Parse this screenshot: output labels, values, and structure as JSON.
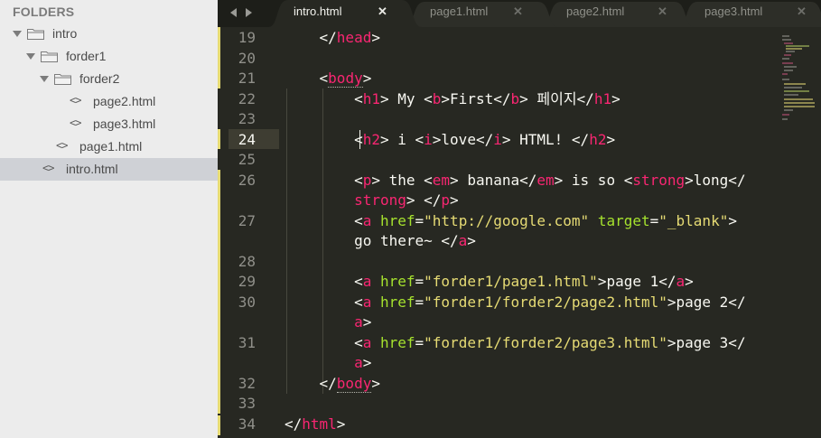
{
  "sidebar": {
    "header": "FOLDERS",
    "items": [
      {
        "label": "intro",
        "type": "folder",
        "expanded": true,
        "selected": false
      },
      {
        "label": "forder1",
        "type": "folder",
        "expanded": true,
        "selected": false
      },
      {
        "label": "forder2",
        "type": "folder",
        "expanded": true,
        "selected": false
      },
      {
        "label": "page2.html",
        "type": "file",
        "icon": "code-file-icon",
        "selected": false
      },
      {
        "label": "page3.html",
        "type": "file",
        "icon": "code-file-icon",
        "selected": false
      },
      {
        "label": "page1.html",
        "type": "file",
        "icon": "code-file-icon",
        "selected": false
      },
      {
        "label": "intro.html",
        "type": "file",
        "icon": "code-file-icon",
        "selected": true
      }
    ]
  },
  "tabs": [
    {
      "label": "intro.html",
      "active": true,
      "close": "✕"
    },
    {
      "label": "page1.html",
      "active": false,
      "close": "✕"
    },
    {
      "label": "page2.html",
      "active": false,
      "close": "✕"
    },
    {
      "label": "page3.html",
      "active": false,
      "close": "✕"
    }
  ],
  "editor": {
    "current_line": 24,
    "line_numbers": [
      "19",
      "20",
      "21",
      "22",
      "23",
      "24",
      "25",
      "26",
      "27",
      "28",
      "29",
      "30",
      "31",
      "32",
      "33",
      "34"
    ],
    "code_lines": [
      [
        {
          "text": "    </"
        },
        {
          "text": "head",
          "k": "t"
        },
        {
          "text": ">"
        }
      ],
      [],
      [
        {
          "text": "    <"
        },
        {
          "text": "body",
          "k": "t",
          "u": true
        },
        {
          "text": ">"
        }
      ],
      [
        {
          "text": "        <"
        },
        {
          "text": "h1",
          "k": "t"
        },
        {
          "text": "> My <"
        },
        {
          "text": "b",
          "k": "t"
        },
        {
          "text": ">First</"
        },
        {
          "text": "b",
          "k": "t"
        },
        {
          "text": "> 페이지</"
        },
        {
          "text": "h1",
          "k": "t"
        },
        {
          "text": ">"
        }
      ],
      [],
      [
        {
          "text": "        <"
        },
        {
          "text": "h2",
          "k": "t"
        },
        {
          "text": "> i <"
        },
        {
          "text": "i",
          "k": "t"
        },
        {
          "text": ">love</"
        },
        {
          "text": "i",
          "k": "t"
        },
        {
          "text": "> HTML! </"
        },
        {
          "text": "h2",
          "k": "t"
        },
        {
          "text": ">"
        }
      ],
      [],
      [
        {
          "text": "        <"
        },
        {
          "text": "p",
          "k": "t"
        },
        {
          "text": "> the <"
        },
        {
          "text": "em",
          "k": "t"
        },
        {
          "text": "> banana</"
        },
        {
          "text": "em",
          "k": "t"
        },
        {
          "text": "> is so <"
        },
        {
          "text": "strong",
          "k": "t"
        },
        {
          "text": ">long</"
        }
      ],
      [
        {
          "text": "        "
        },
        {
          "text": "strong",
          "k": "t"
        },
        {
          "text": "> </"
        },
        {
          "text": "p",
          "k": "t"
        },
        {
          "text": ">"
        }
      ],
      [
        {
          "text": "        <"
        },
        {
          "text": "a",
          "k": "t"
        },
        {
          "text": " "
        },
        {
          "text": "href",
          "k": "a"
        },
        {
          "text": "="
        },
        {
          "text": "\"http://google.com\"",
          "k": "s"
        },
        {
          "text": " "
        },
        {
          "text": "target",
          "k": "a"
        },
        {
          "text": "="
        },
        {
          "text": "\"_blank\"",
          "k": "s"
        },
        {
          "text": ">"
        }
      ],
      [
        {
          "text": "        go there~ </"
        },
        {
          "text": "a",
          "k": "t"
        },
        {
          "text": ">"
        }
      ],
      [],
      [
        {
          "text": "        <"
        },
        {
          "text": "a",
          "k": "t"
        },
        {
          "text": " "
        },
        {
          "text": "href",
          "k": "a"
        },
        {
          "text": "="
        },
        {
          "text": "\"forder1/page1.html\"",
          "k": "s"
        },
        {
          "text": ">page 1</"
        },
        {
          "text": "a",
          "k": "t"
        },
        {
          "text": ">"
        }
      ],
      [
        {
          "text": "        <"
        },
        {
          "text": "a",
          "k": "t"
        },
        {
          "text": " "
        },
        {
          "text": "href",
          "k": "a"
        },
        {
          "text": "="
        },
        {
          "text": "\"forder1/forder2/page2.html\"",
          "k": "s"
        },
        {
          "text": ">page 2</"
        }
      ],
      [
        {
          "text": "        "
        },
        {
          "text": "a",
          "k": "t"
        },
        {
          "text": ">"
        }
      ],
      [
        {
          "text": "        <"
        },
        {
          "text": "a",
          "k": "t"
        },
        {
          "text": " "
        },
        {
          "text": "href",
          "k": "a"
        },
        {
          "text": "="
        },
        {
          "text": "\"forder1/forder2/page3.html\"",
          "k": "s"
        },
        {
          "text": ">page 3</"
        }
      ],
      [
        {
          "text": "        "
        },
        {
          "text": "a",
          "k": "t"
        },
        {
          "text": ">"
        }
      ],
      [
        {
          "text": "    </"
        },
        {
          "text": "body",
          "k": "t",
          "u": true
        },
        {
          "text": ">"
        }
      ],
      [],
      [
        {
          "text": "</"
        },
        {
          "text": "html",
          "k": "t"
        },
        {
          "text": ">"
        }
      ]
    ]
  },
  "colors": {
    "editor_bg": "#272822",
    "sidebar_bg": "#ececec",
    "tag": "#f92672",
    "attribute": "#a6e22e",
    "string": "#e6db74",
    "text": "#f8f8f2",
    "line_number": "#90908a"
  }
}
